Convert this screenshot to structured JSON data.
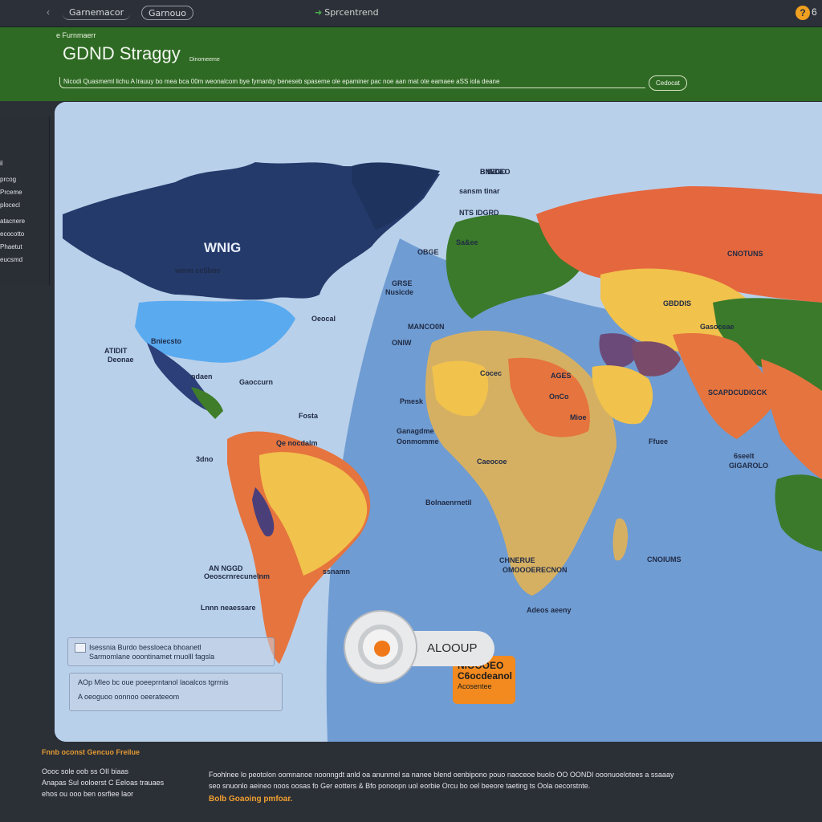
{
  "topbar": {
    "back": "‹",
    "tabs": [
      "Garnemacor",
      "Garnouo",
      "Sprcentrend"
    ],
    "coins": "6"
  },
  "header": {
    "overline": "e Furnmaerr",
    "title": "GDND Straggy",
    "subtitle": "Dinomeeme",
    "ticker": "Nicodi Quasmeml lichu   A lrauuy bo mea bca 00m weonalcom bye fymanby beneseb spaseme ole epaminer pac noe aan mat ote eamaee aSS iola deane",
    "pill": "Cedocat"
  },
  "sidepanel": {
    "items": [
      "il",
      "prcog",
      "Prceme",
      "plocecl",
      "atacnere",
      "ecocotto",
      "Phaetut",
      "eucsmd"
    ]
  },
  "map": {
    "big_label": "WNIG",
    "labels": [
      "BNEGO",
      "wmm cc5bne",
      "Oeocal",
      "ATIDIT",
      "Deonae",
      "Bniecsto",
      "ndaen",
      "Gaoccurn",
      "3dno",
      "Fosta",
      "Qe nocdalm",
      "ssnamn",
      "AN NGGD",
      "Oeoscrnrecunelnm",
      "Lnnn neaessare",
      "BIINDEO",
      "sansm tinar",
      "NTS IDGRD",
      "Sa&ee",
      "OBGE",
      "GRSE",
      "Nusicde",
      "MANCO0N",
      "ONIW",
      "Cocec",
      "Pmesk",
      "Ganagdme",
      "Oonmomme",
      "Caeocoe",
      "Ffuee",
      "CNOTUNS",
      "GBDDIS",
      "Gasoceae",
      "Mioe",
      "OnCo",
      "AGES",
      "Bolnaenrnetil",
      "CHNERUE",
      "OMOOOERECNON",
      "Adeos aeeny",
      "CNOIUMS",
      "SCAPDCUDIGCK",
      "6seelt",
      "GIGAROLO"
    ]
  },
  "quest": {
    "line1": "NIOOOEO",
    "line2": "C6ocdeanol",
    "line3": "Acosentee"
  },
  "action": {
    "label": "ALOOUP"
  },
  "infobox1": {
    "line1": "Isessnia Burdo bessloeca bhoanetl",
    "line2": "Sarmomlane ooontinamet rnuolll fagsla"
  },
  "infobox2": {
    "line1": "AOp Mleo bc oue poeeprntanol laoalcos tgrrnis",
    "line2": "A oeoguoo oonnoo oeerateeom"
  },
  "footer": {
    "title": "Fnnb oconst Gencuo Freilue",
    "left": [
      "Oooc sole oob ss OII biaas",
      "Anapas Sul ooloerst C Eeloas trauaes",
      "ehos ou ooo ben osrfiee laor"
    ],
    "right": [
      "Foohlnee lo peotolon oomnanoe noonngdt anld oa  anunmel sa nanee blend oenbipono pouo naoceoe buolo OO OONDI ooonuoelotees a ssaaay",
      "seo snuonlo aeineo noos oosas fo Ger eotters & Bfo ponoopn uol eorbie Orcu bo oel beeore taeting ts Oola oecorstnte."
    ],
    "link": "Bolb Goaoing pmfoar."
  }
}
